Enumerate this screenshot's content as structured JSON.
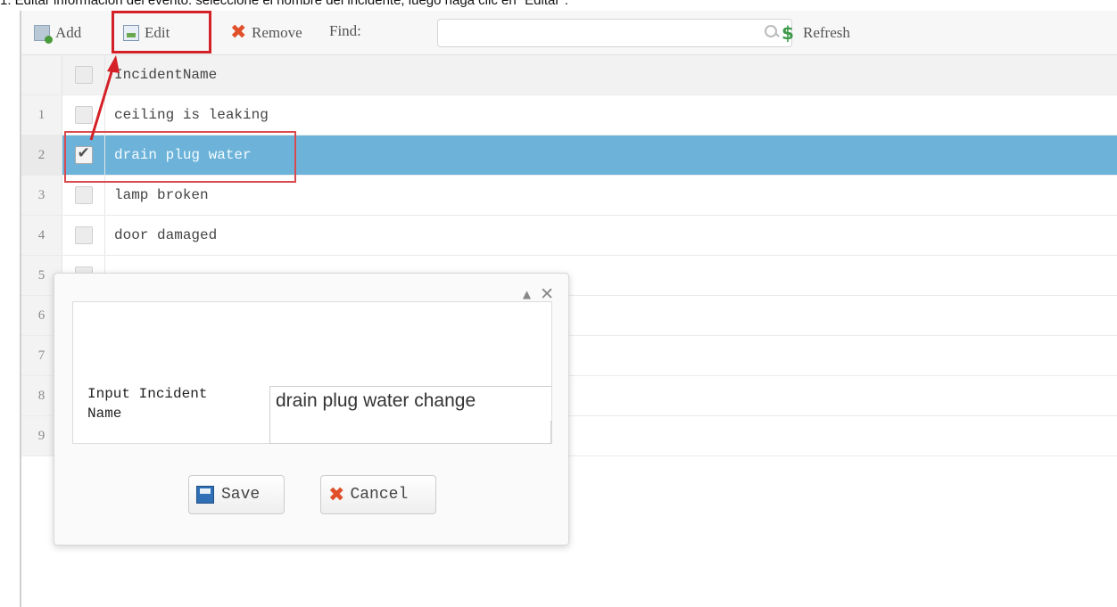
{
  "caption": "1. Editar información del evento: seleccione el nombre del incidente, luego haga clic en \"Editar\".",
  "toolbar": {
    "add_label": "Add",
    "edit_label": "Edit",
    "remove_label": "Remove",
    "find_label": "Find:",
    "search_value": "",
    "refresh_label": "Refresh"
  },
  "grid": {
    "column_header": "IncidentName",
    "rows": [
      {
        "num": "1",
        "name": "ceiling is leaking",
        "checked": false
      },
      {
        "num": "2",
        "name": "drain plug water",
        "checked": true
      },
      {
        "num": "3",
        "name": "lamp broken",
        "checked": false
      },
      {
        "num": "4",
        "name": "door damaged",
        "checked": false
      },
      {
        "num": "5",
        "name": "",
        "checked": false
      },
      {
        "num": "6",
        "name": "",
        "checked": false
      },
      {
        "num": "7",
        "name": "",
        "checked": false
      },
      {
        "num": "8",
        "name": "",
        "checked": false
      },
      {
        "num": "9",
        "name": "",
        "checked": false
      }
    ]
  },
  "dialog": {
    "field_label": "Input Incident Name",
    "field_value": "drain plug water change",
    "save_label": "Save",
    "cancel_label": "Cancel"
  },
  "colors": {
    "highlight_red": "#d42127",
    "selected_row": "#6db3d9"
  }
}
